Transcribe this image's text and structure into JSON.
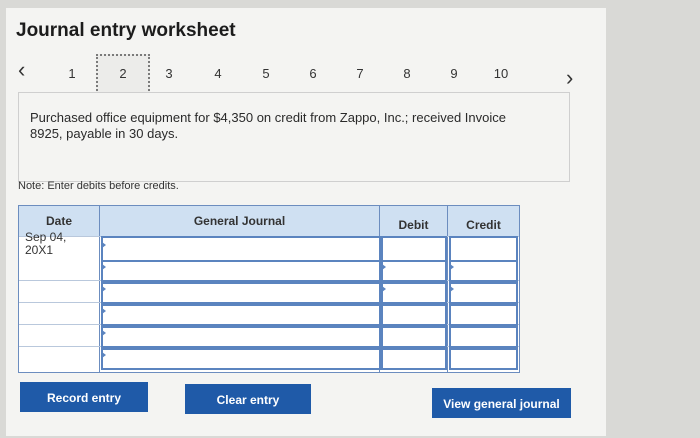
{
  "title": "Journal entry worksheet",
  "nav": {
    "prev_icon": "chevron-left-icon",
    "next_icon": "chevron-right-icon",
    "tabs": [
      "1",
      "2",
      "3",
      "4",
      "5",
      "6",
      "7",
      "8",
      "9",
      "10"
    ],
    "active_tab": "2"
  },
  "prompt": "Purchased office equipment for $4,350 on credit from Zappo, Inc.; received Invoice 8925, payable in 30 days.",
  "note": "Note: Enter debits before credits.",
  "table": {
    "headers": {
      "date": "Date",
      "journal": "General Journal",
      "debit": "Debit",
      "credit": "Credit"
    },
    "first_date": "Sep 04, 20X1"
  },
  "buttons": {
    "record": "Record entry",
    "clear": "Clear entry",
    "view": "View general journal"
  },
  "colors": {
    "accent": "#1f5aa8",
    "header": "#cfe0f2",
    "border": "#5b84bf"
  }
}
